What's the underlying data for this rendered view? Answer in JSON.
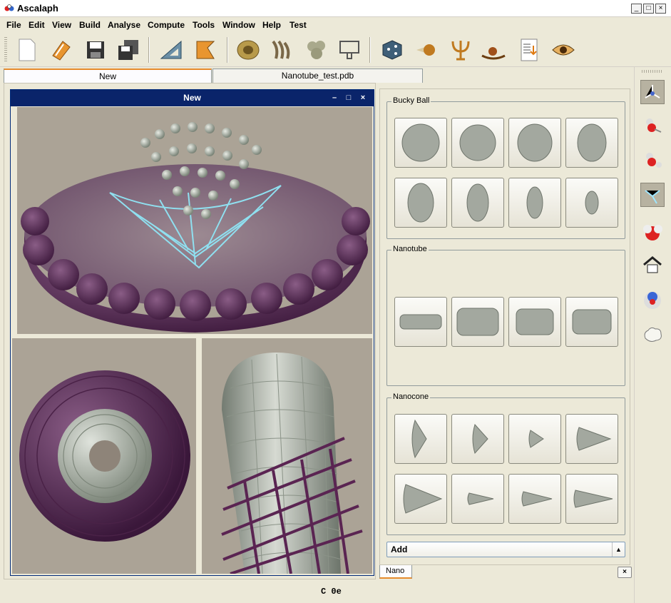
{
  "window": {
    "title": "Ascalaph"
  },
  "menu": [
    "File",
    "Edit",
    "View",
    "Build",
    "Analyse",
    "Compute",
    "Tools",
    "Window",
    "Help",
    "Test"
  ],
  "toolbar": {
    "icons": [
      "new-document-icon",
      "open-book-icon",
      "save-icon",
      "save-all-icon",
      "geometry-triangle-icon",
      "minimize-arrow-icon",
      "molecule-shell-icon",
      "protein-icon",
      "cluster-icon",
      "magnet-icon",
      "dice-icon",
      "projectile-icon",
      "psi-icon",
      "bowl-ball-icon",
      "data-report-icon",
      "eye-icon"
    ]
  },
  "doc_tabs": [
    {
      "label": "New",
      "active": true
    },
    {
      "label": "Nanotube_test.pdb",
      "active": false
    }
  ],
  "mdi": {
    "title": "New"
  },
  "status": "C  0e",
  "panel": {
    "groups": [
      {
        "label": "Bucky Ball",
        "count": 8
      },
      {
        "label": "Nanotube",
        "count": 4
      },
      {
        "label": "Nanocone",
        "count": 8
      }
    ],
    "combo_value": "Add",
    "tab": "Nano",
    "close": "×"
  },
  "sidebar": {
    "icons": [
      "atom-axes-icon",
      "hydroxyl-icon",
      "water-icon",
      "bond-icon",
      "water-sphere-icon",
      "house-icon",
      "sphere-model-icon",
      "surface-icon"
    ]
  },
  "colors": {
    "mdi_title": "#0a246a",
    "tab_accent": "#e68b2c",
    "carbon": "#9aa39a",
    "membrane": "#5a2d55",
    "wire": "#8fe0f0"
  }
}
